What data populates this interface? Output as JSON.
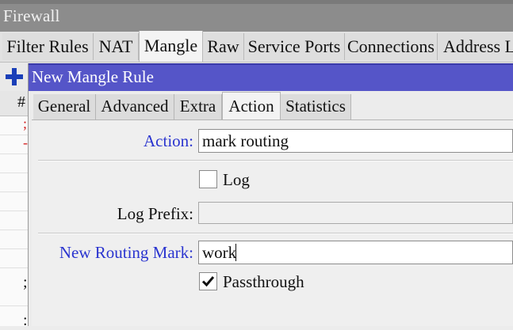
{
  "firewall": {
    "title": "Firewall",
    "tabs": [
      "Filter Rules",
      "NAT",
      "Mangle",
      "Raw",
      "Service Ports",
      "Connections",
      "Address L"
    ],
    "active_tab": "Mangle",
    "list_header": "#"
  },
  "dialog": {
    "title": "New Mangle Rule",
    "tabs": [
      "General",
      "Advanced",
      "Extra",
      "Action",
      "Statistics"
    ],
    "active_tab": "Action",
    "action_label": "Action:",
    "action_value": "mark routing",
    "log_label": "Log",
    "log_checked": false,
    "log_prefix_label": "Log Prefix:",
    "log_prefix_value": "",
    "routing_mark_label": "New Routing Mark:",
    "routing_mark_value": "work",
    "passthrough_label": "Passthrough",
    "passthrough_checked": true
  },
  "colors": {
    "dialog_title_bar": "#5555c8",
    "accent_label": "#2a34cf",
    "add_icon": "#1a3fb8"
  }
}
